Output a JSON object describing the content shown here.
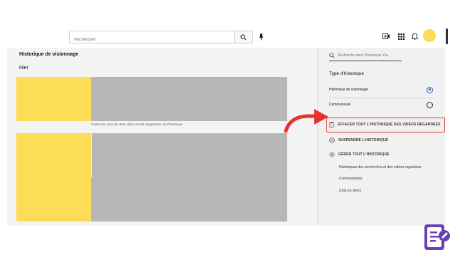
{
  "header": {
    "search_placeholder": "Rechercher",
    "icons": [
      "search-icon",
      "mic-icon",
      "create-icon",
      "apps-icon",
      "bell-icon"
    ]
  },
  "main": {
    "title": "Historique de visionnage",
    "date_group": "Hier",
    "removed_note": "Toutes les vues de cette vidéo ont été supprimées de l'historique"
  },
  "sidebar": {
    "search_placeholder": "Recherche dans l'historique You...",
    "type_heading": "Type d'historique",
    "options": [
      {
        "label": "Historique de visionnage",
        "selected": true
      },
      {
        "label": "Communauté",
        "selected": false
      }
    ],
    "actions": [
      {
        "label": "EFFACER TOUT L'HISTORIQUE DES VIDÉOS REGARDÉES",
        "icon": "trash-icon"
      },
      {
        "label": "SUSPENDRE L'HISTORIQUE",
        "icon": "pause-icon"
      },
      {
        "label": "GÉRER TOUT L'HISTORIQUE",
        "icon": "gear-icon"
      }
    ],
    "links": [
      "Historiques des recherches et des vidéos regardées",
      "Commentaires",
      "Chat en direct"
    ]
  },
  "colors": {
    "thumbnail": "#fddc56",
    "placeholder_gray": "#b7b7b7",
    "highlight": "#e23b3b",
    "radio_selected": "#2463d6"
  }
}
